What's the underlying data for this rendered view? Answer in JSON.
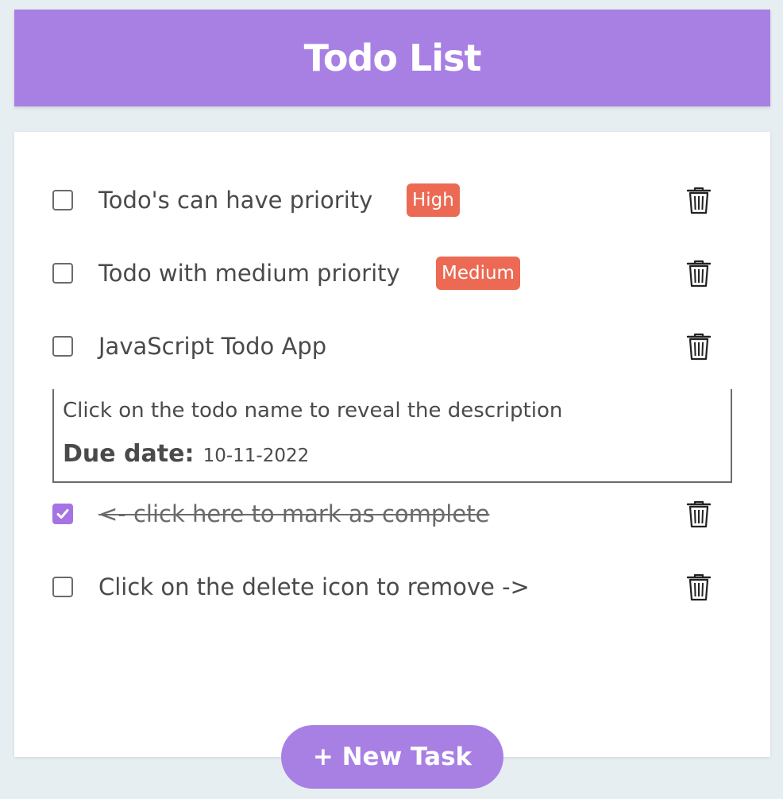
{
  "app": {
    "title": "Todo List"
  },
  "todos": [
    {
      "text": "Todo's can have priority",
      "priority": "High",
      "completed": false
    },
    {
      "text": "Todo with medium priority",
      "priority": "Medium",
      "completed": false
    },
    {
      "text": "JavaScript Todo App",
      "priority": "",
      "completed": false,
      "description": "Click on the todo name to reveal the description",
      "due_label": "Due date:",
      "due_date": "10-11-2022"
    },
    {
      "text": "<- click here to mark as complete",
      "priority": "",
      "completed": true
    },
    {
      "text": "Click on the delete icon to remove ->",
      "priority": "",
      "completed": false
    }
  ],
  "new_task_label": "+ New Task",
  "colors": {
    "accent": "#a880e4",
    "badge": "#ec6a54",
    "background": "#e7eef2"
  },
  "icons": {
    "delete": "trash-icon",
    "check": "check-icon"
  }
}
